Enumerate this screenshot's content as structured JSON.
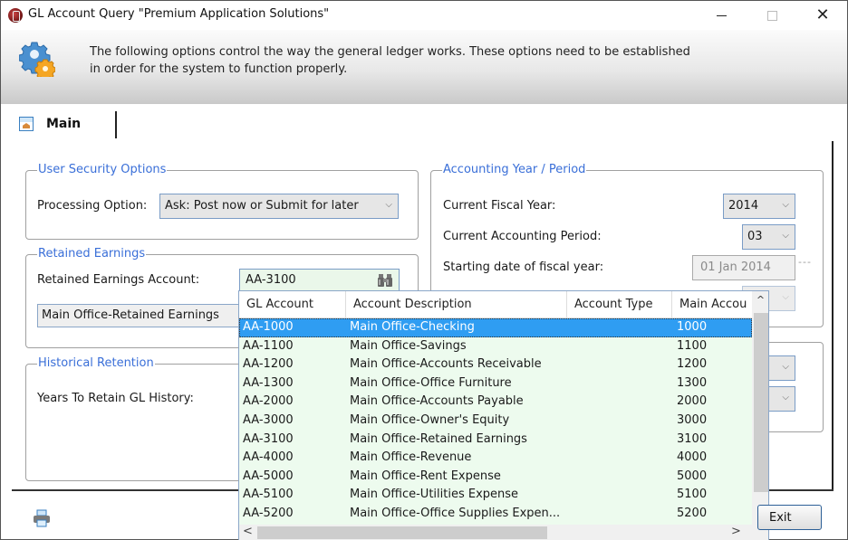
{
  "window": {
    "title": "GL Account Query \"Premium Application Solutions\"",
    "controls": {
      "minimize": "minimize",
      "maximize": "maximize",
      "close": "close"
    }
  },
  "header": {
    "line1": "The following options control the way the general ledger works.  These options need to be established",
    "line2": "in order for the system to function properly."
  },
  "tabs": [
    {
      "label": "Main",
      "icon": "home-icon",
      "active": true
    }
  ],
  "user_security": {
    "legend": "User Security Options",
    "processing_label": "Processing Option:",
    "processing_value": "Ask: Post now or Submit for later"
  },
  "retained_earnings": {
    "legend": "Retained Earnings",
    "account_label": "Retained Earnings Account:",
    "account_value": "AA-3100",
    "account_description": "Main Office-Retained Earnings"
  },
  "historical_retention": {
    "legend": "Historical Retention",
    "years_label": "Years To Retain GL History:"
  },
  "accounting_period": {
    "legend": "Accounting Year / Period",
    "fiscal_year_label": "Current Fiscal Year:",
    "fiscal_year_value": "2014",
    "period_label": "Current Accounting Period:",
    "period_value": "03",
    "start_date_label": "Starting date of fiscal year:",
    "start_date_value": "01 Jan 2014",
    "dashes": "---"
  },
  "lookup_grid": {
    "columns": [
      "GL Account",
      "Account Description",
      "Account Type",
      "Main Accou"
    ],
    "selected_index": 0,
    "rows": [
      {
        "account": "AA-1000",
        "description": "Main Office-Checking",
        "type": "",
        "main": "1000"
      },
      {
        "account": "AA-1100",
        "description": "Main Office-Savings",
        "type": "",
        "main": "1100"
      },
      {
        "account": "AA-1200",
        "description": "Main Office-Accounts Receivable",
        "type": "",
        "main": "1200"
      },
      {
        "account": "AA-1300",
        "description": "Main Office-Office Furniture",
        "type": "",
        "main": "1300"
      },
      {
        "account": "AA-2000",
        "description": "Main Office-Accounts Payable",
        "type": "",
        "main": "2000"
      },
      {
        "account": "AA-3000",
        "description": "Main Office-Owner's Equity",
        "type": "",
        "main": "3000"
      },
      {
        "account": "AA-3100",
        "description": "Main Office-Retained Earnings",
        "type": "",
        "main": "3100"
      },
      {
        "account": "AA-4000",
        "description": "Main Office-Revenue",
        "type": "",
        "main": "4000"
      },
      {
        "account": "AA-5000",
        "description": "Main Office-Rent Expense",
        "type": "",
        "main": "5000"
      },
      {
        "account": "AA-5100",
        "description": "Main Office-Utilities Expense",
        "type": "",
        "main": "5100"
      },
      {
        "account": "AA-5200",
        "description": "Main Office-Office Supplies Expen...",
        "type": "",
        "main": "5200"
      }
    ],
    "scroll_up": "^",
    "scroll_down": "v",
    "scroll_left": "<",
    "scroll_right": ">"
  },
  "footer": {
    "exit_label": "Exit"
  },
  "colors": {
    "accent_legend": "#3a6fd8",
    "selection": "#2f9df2",
    "grid_background": "#edfbee"
  }
}
